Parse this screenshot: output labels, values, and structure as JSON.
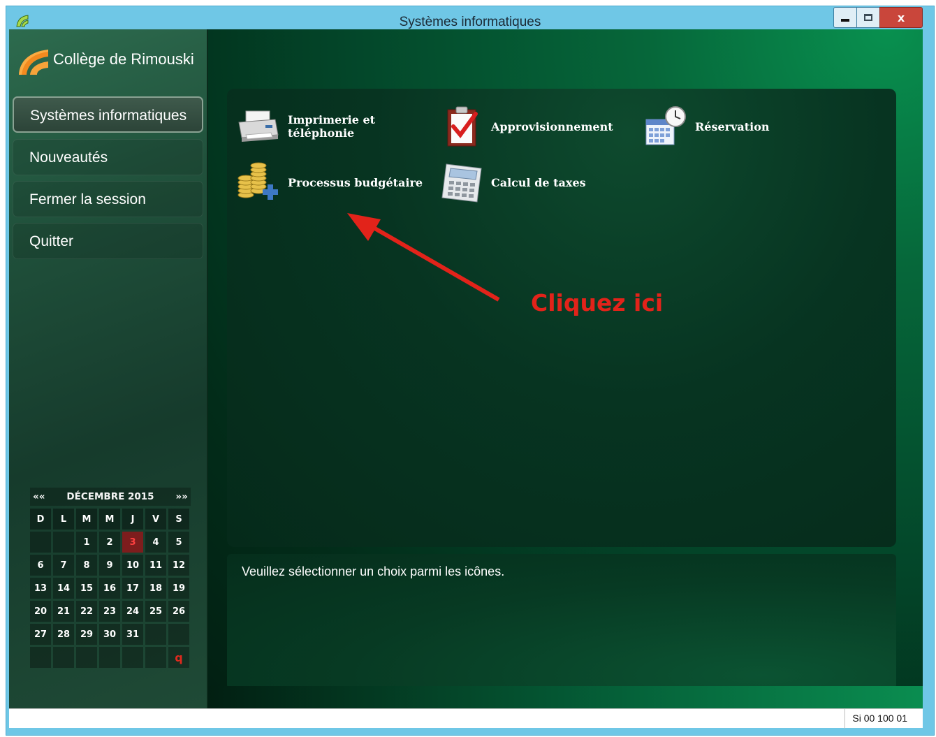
{
  "window": {
    "title": "Systèmes informatiques",
    "close_label": "x"
  },
  "sidebar": {
    "college_name": "Collège de Rimouski",
    "items": [
      {
        "label": "Systèmes informatiques",
        "active": true
      },
      {
        "label": "Nouveautés"
      },
      {
        "label": "Fermer la session"
      },
      {
        "label": "Quitter"
      }
    ]
  },
  "calendar": {
    "prev_label": "««",
    "month_label": "DÉCEMBRE 2015",
    "next_label": "»»",
    "weekdays": [
      "D",
      "L",
      "M",
      "M",
      "J",
      "V",
      "S"
    ],
    "weeks": [
      [
        "",
        "",
        "1",
        "2",
        "3",
        "4",
        "5"
      ],
      [
        "6",
        "7",
        "8",
        "9",
        "10",
        "11",
        "12"
      ],
      [
        "13",
        "14",
        "15",
        "16",
        "17",
        "18",
        "19"
      ],
      [
        "20",
        "21",
        "22",
        "23",
        "24",
        "25",
        "26"
      ],
      [
        "27",
        "28",
        "29",
        "30",
        "31",
        "",
        ""
      ],
      [
        "",
        "",
        "",
        "",
        "",
        "",
        "q"
      ]
    ],
    "today": "3"
  },
  "apps": [
    {
      "line1": "Imprimerie et",
      "line2": "téléphonie",
      "icon": "printer-icon"
    },
    {
      "line1": "Approvisionnement",
      "line2": "",
      "icon": "clipboard-check-icon"
    },
    {
      "line1": "Réservation",
      "line2": "",
      "icon": "calendar-clock-icon"
    },
    {
      "line1": "Processus budgétaire",
      "line2": "",
      "icon": "coins-plus-icon"
    },
    {
      "line1": "Calcul de taxes",
      "line2": "",
      "icon": "calculator-icon"
    }
  ],
  "message": "Veuillez sélectionner un choix parmi les icônes.",
  "annotation": "Cliquez ici",
  "status": {
    "code": "Si 00 100 01"
  },
  "colors": {
    "annotation": "#e2231a",
    "title_bar": "#6fc7e6",
    "today": "#7d1d1d"
  }
}
